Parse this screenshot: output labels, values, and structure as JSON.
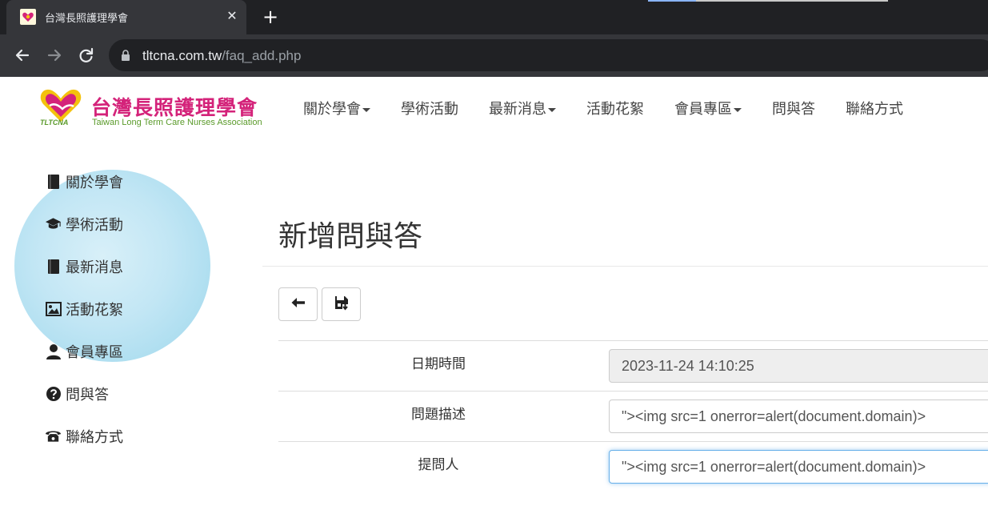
{
  "browser": {
    "tab_title": "台灣長照護理學會",
    "tab_close": "✕",
    "new_tab": "+",
    "url_host": "tltcna.com.tw",
    "url_path": "/faq_add.php"
  },
  "site": {
    "logo_cn": "台灣長照護理學會",
    "logo_en": "Taiwan Long Term Care Nurses Association",
    "logo_abbr": "TLTCNA",
    "brand_colors": {
      "pink": "#d4237a",
      "green": "#5a9a2a",
      "yellow": "#f4c20d"
    }
  },
  "nav": {
    "items": [
      {
        "label": "關於學會",
        "dropdown": true
      },
      {
        "label": "學術活動",
        "dropdown": false
      },
      {
        "label": "最新消息",
        "dropdown": true
      },
      {
        "label": "活動花絮",
        "dropdown": false
      },
      {
        "label": "會員專區",
        "dropdown": true
      },
      {
        "label": "問與答",
        "dropdown": false
      },
      {
        "label": "聯絡方式",
        "dropdown": false
      }
    ]
  },
  "sidebar": {
    "items": [
      {
        "label": "關於學會",
        "icon": "book-icon"
      },
      {
        "label": "學術活動",
        "icon": "graduation-cap-icon"
      },
      {
        "label": "最新消息",
        "icon": "book-icon"
      },
      {
        "label": "活動花絮",
        "icon": "picture-icon"
      },
      {
        "label": "會員專區",
        "icon": "user-icon"
      },
      {
        "label": "問與答",
        "icon": "question-circle-icon"
      },
      {
        "label": "聯絡方式",
        "icon": "phone-icon"
      }
    ]
  },
  "main": {
    "title": "新增問與答",
    "buttons": {
      "back_icon": "arrow-left-icon",
      "save_icon": "save-icon"
    },
    "form": {
      "fields": [
        {
          "label": "日期時間",
          "value": "2023-11-24 14:10:25"
        },
        {
          "label": "問題描述",
          "value": "\"><img src=1 onerror=alert(document.domain)>"
        },
        {
          "label": "提問人",
          "value": "\"><img src=1 onerror=alert(document.domain)>"
        }
      ]
    }
  }
}
